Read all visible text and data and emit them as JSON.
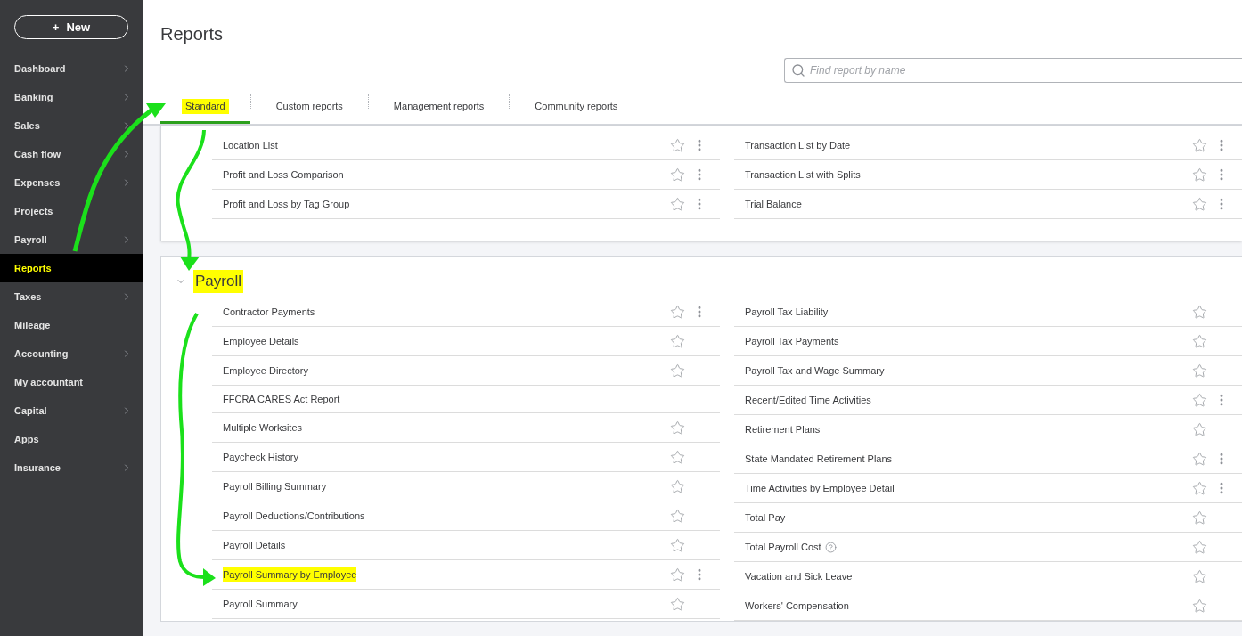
{
  "sidebar": {
    "new_button": {
      "icon_text": "+",
      "label": "New"
    },
    "items": [
      {
        "label": "Dashboard",
        "submenu": true,
        "selected": false
      },
      {
        "label": "Banking",
        "submenu": true,
        "selected": false
      },
      {
        "label": "Sales",
        "submenu": true,
        "selected": false
      },
      {
        "label": "Cash flow",
        "submenu": true,
        "selected": false
      },
      {
        "label": "Expenses",
        "submenu": true,
        "selected": false
      },
      {
        "label": "Projects",
        "submenu": false,
        "selected": false
      },
      {
        "label": "Payroll",
        "submenu": true,
        "selected": false
      },
      {
        "label": "Reports",
        "submenu": false,
        "selected": true
      },
      {
        "label": "Taxes",
        "submenu": true,
        "selected": false
      },
      {
        "label": "Mileage",
        "submenu": false,
        "selected": false
      },
      {
        "label": "Accounting",
        "submenu": true,
        "selected": false
      },
      {
        "label": "My accountant",
        "submenu": false,
        "selected": false
      },
      {
        "label": "Capital",
        "submenu": true,
        "selected": false
      },
      {
        "label": "Apps",
        "submenu": false,
        "selected": false
      },
      {
        "label": "Insurance",
        "submenu": true,
        "selected": false
      }
    ]
  },
  "page_title": "Reports",
  "search": {
    "placeholder": "Find report by name"
  },
  "tabs": [
    {
      "label": "Standard",
      "selected": true,
      "highlighted": true
    },
    {
      "label": "Custom reports",
      "selected": false,
      "highlighted": false
    },
    {
      "label": "Management reports",
      "selected": false,
      "highlighted": false
    },
    {
      "label": "Community reports",
      "selected": false,
      "highlighted": false
    }
  ],
  "sections": [
    {
      "columns": [
        [
          {
            "name": "Location List",
            "star": true,
            "more_menu": true,
            "help": false,
            "highlighted": false
          },
          {
            "name": "Profit and Loss Comparison",
            "star": true,
            "more_menu": true,
            "help": false,
            "highlighted": false
          },
          {
            "name": "Profit and Loss by Tag Group",
            "star": true,
            "more_menu": true,
            "help": false,
            "highlighted": false
          }
        ],
        [
          {
            "name": "Transaction List by Date",
            "star": true,
            "more_menu": true,
            "help": false,
            "highlighted": false
          },
          {
            "name": "Transaction List with Splits",
            "star": true,
            "more_menu": true,
            "help": false,
            "highlighted": false
          },
          {
            "name": "Trial Balance",
            "star": true,
            "more_menu": true,
            "help": false,
            "highlighted": false
          }
        ]
      ]
    },
    {
      "title": "Payroll",
      "title_highlighted": true,
      "expanded": true,
      "columns": [
        [
          {
            "name": "Contractor Payments",
            "star": true,
            "more_menu": true,
            "help": false,
            "highlighted": false
          },
          {
            "name": "Employee Details",
            "star": true,
            "more_menu": false,
            "help": false,
            "highlighted": false
          },
          {
            "name": "Employee Directory",
            "star": true,
            "more_menu": false,
            "help": false,
            "highlighted": false
          },
          {
            "name": "FFCRA CARES Act Report",
            "star": false,
            "more_menu": false,
            "help": false,
            "highlighted": false
          },
          {
            "name": "Multiple Worksites",
            "star": true,
            "more_menu": false,
            "help": false,
            "highlighted": false
          },
          {
            "name": "Paycheck History",
            "star": true,
            "more_menu": false,
            "help": false,
            "highlighted": false
          },
          {
            "name": "Payroll Billing Summary",
            "star": true,
            "more_menu": false,
            "help": false,
            "highlighted": false
          },
          {
            "name": "Payroll Deductions/Contributions",
            "star": true,
            "more_menu": false,
            "help": false,
            "highlighted": false
          },
          {
            "name": "Payroll Details",
            "star": true,
            "more_menu": false,
            "help": false,
            "highlighted": false
          },
          {
            "name": "Payroll Summary by Employee",
            "star": true,
            "more_menu": true,
            "help": false,
            "highlighted": true
          },
          {
            "name": "Payroll Summary",
            "star": true,
            "more_menu": false,
            "help": false,
            "highlighted": false
          }
        ],
        [
          {
            "name": "Payroll Tax Liability",
            "star": true,
            "more_menu": false,
            "help": false,
            "highlighted": false
          },
          {
            "name": "Payroll Tax Payments",
            "star": true,
            "more_menu": false,
            "help": false,
            "highlighted": false
          },
          {
            "name": "Payroll Tax and Wage Summary",
            "star": true,
            "more_menu": false,
            "help": false,
            "highlighted": false
          },
          {
            "name": "Recent/Edited Time Activities",
            "star": true,
            "more_menu": true,
            "help": false,
            "highlighted": false
          },
          {
            "name": "Retirement Plans",
            "star": true,
            "more_menu": false,
            "help": false,
            "highlighted": false
          },
          {
            "name": "State Mandated Retirement Plans",
            "star": true,
            "more_menu": true,
            "help": false,
            "highlighted": false
          },
          {
            "name": "Time Activities by Employee Detail",
            "star": true,
            "more_menu": true,
            "help": false,
            "highlighted": false
          },
          {
            "name": "Total Pay",
            "star": true,
            "more_menu": false,
            "help": false,
            "highlighted": false
          },
          {
            "name": "Total Payroll Cost",
            "star": true,
            "more_menu": false,
            "help": true,
            "highlighted": false
          },
          {
            "name": "Vacation and Sick Leave",
            "star": true,
            "more_menu": false,
            "help": false,
            "highlighted": false
          },
          {
            "name": "Workers' Compensation",
            "star": true,
            "more_menu": false,
            "help": false,
            "highlighted": false
          }
        ]
      ]
    }
  ]
}
